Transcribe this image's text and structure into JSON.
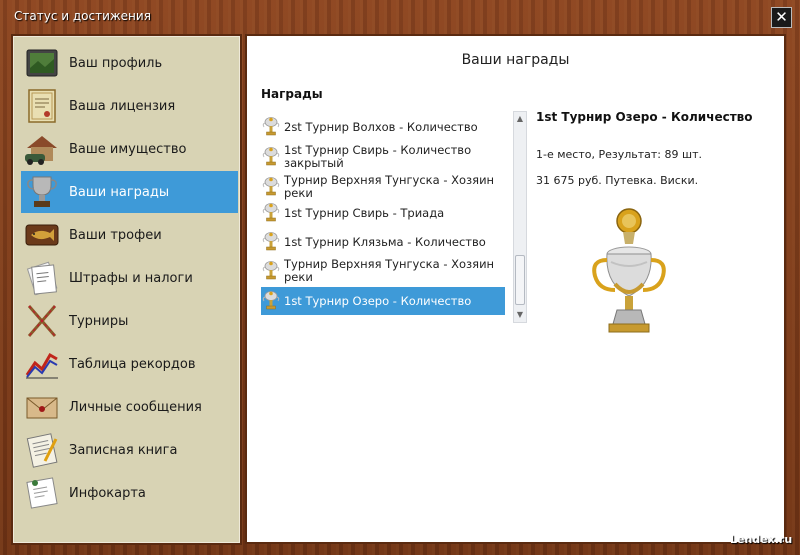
{
  "window": {
    "title": "Статус и достижения",
    "close_symbol": "✕"
  },
  "sidebar": {
    "items": [
      {
        "label": "Ваш профиль",
        "icon": "profile-photo-icon"
      },
      {
        "label": "Ваша лицензия",
        "icon": "license-document-icon"
      },
      {
        "label": "Ваше имущество",
        "icon": "property-house-icon"
      },
      {
        "label": "Ваши награды",
        "icon": "trophy-icon",
        "active": true
      },
      {
        "label": "Ваши трофеи",
        "icon": "fish-trophy-icon"
      },
      {
        "label": "Штрафы и налоги",
        "icon": "fines-papers-icon"
      },
      {
        "label": "Турниры",
        "icon": "crossed-rods-icon"
      },
      {
        "label": "Таблица рекордов",
        "icon": "records-chart-icon"
      },
      {
        "label": "Личные сообщения",
        "icon": "envelope-icon"
      },
      {
        "label": "Записная книга",
        "icon": "notebook-icon"
      },
      {
        "label": "Инфокарта",
        "icon": "info-card-icon"
      }
    ]
  },
  "main": {
    "title": "Ваши награды",
    "awards_section_title": "Награды",
    "awards": [
      {
        "label": "2st Турнир Волхов - Количество"
      },
      {
        "label": "1st Турнир Свирь - Количество закрытый"
      },
      {
        "label": "Турнир Верхняя Тунгуска - Хозяин реки"
      },
      {
        "label": "1st Турнир Свирь - Триада"
      },
      {
        "label": "1st Турнир Клязьма - Количество"
      },
      {
        "label": "Турнир Верхняя Тунгуска - Хозяин реки"
      },
      {
        "label": "1st Турнир Озеро - Количество",
        "selected": true
      }
    ],
    "detail": {
      "title": "1st Турнир Озеро - Количество",
      "result": "1-е место, Результат: 89 шт.",
      "prize": "31 675 руб. Путевка. Виски."
    }
  },
  "watermark": "Lendex.ru",
  "colors": {
    "accent": "#3e9ad8",
    "sidebar_bg": "#d8d3b4",
    "frame": "#7a3a18"
  }
}
